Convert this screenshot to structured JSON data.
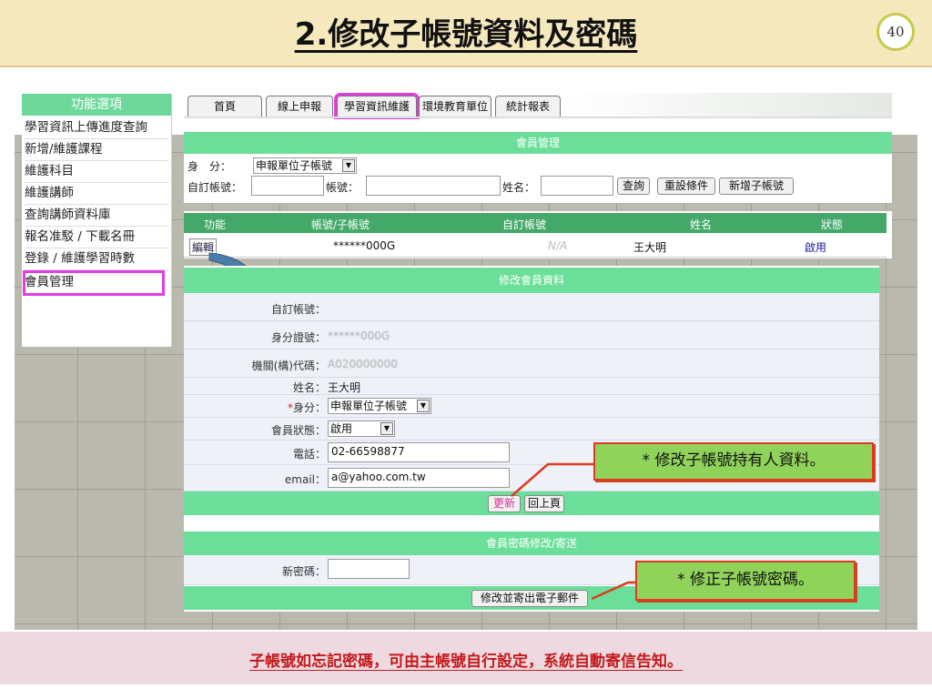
{
  "slide": {
    "title": "2.修改子帳號資料及密碼",
    "page_number": "40",
    "footer": "子帳號如忘記密碼，可由主帳號自行設定，系統自動寄信告知。"
  },
  "sidebar": {
    "header": "功能選項",
    "items": [
      {
        "label": "學習資訊上傳進度查詢"
      },
      {
        "label": "新增/維護課程"
      },
      {
        "label": "維護科目"
      },
      {
        "label": "維護講師"
      },
      {
        "label": "查詢講師資料庫"
      },
      {
        "label": "報名准駁 / 下載名冊"
      },
      {
        "label": "登錄 / 維護學習時數"
      },
      {
        "label": "會員管理"
      }
    ]
  },
  "tabs": [
    {
      "label": "首頁"
    },
    {
      "label": "線上申報"
    },
    {
      "label": "學習資訊維護"
    },
    {
      "label": "環境教育單位"
    },
    {
      "label": "統計報表"
    }
  ],
  "member_mgmt": {
    "title": "會員管理",
    "identity_label": "身　分：",
    "identity_value": "申報單位子帳號",
    "custom_account_label": "自訂帳號：",
    "account_label": "帳號：",
    "name_label": "姓名：",
    "buttons": {
      "query": "查詢",
      "reset": "重設條件",
      "add_sub": "新增子帳號"
    },
    "columns": [
      "功能",
      "帳號/子帳號",
      "自訂帳號",
      "姓名",
      "狀態"
    ],
    "row": {
      "action": "編輯",
      "account": "******000G",
      "custom": "N/A",
      "name": "王大明",
      "status": "啟用"
    }
  },
  "edit_member": {
    "title": "修改會員資料",
    "fields": {
      "custom_account_label": "自訂帳號：",
      "id_label": "身分證號：",
      "id_value": "******000G",
      "org_label": "機關(構)代碼：",
      "org_value": "A020000000",
      "name_label": "姓名：",
      "name_value": "王大明",
      "identity_star": "*",
      "identity_label": "身分：",
      "identity_value": "申報單位子帳號",
      "status_label": "會員狀態：",
      "status_value": "啟用",
      "phone_label": "電話：",
      "phone_value": "02-66598877",
      "email_label": "email：",
      "email_value": "a@yahoo.com.tw"
    },
    "buttons": {
      "update": "更新",
      "back": "回上頁"
    }
  },
  "password": {
    "title": "會員密碼修改/寄送",
    "new_pw_label": "新密碼：",
    "new_pw_value": "",
    "send_button": "修改並寄出電子郵件"
  },
  "callouts": {
    "edit_info": "* 修改子帳號持有人資料。",
    "change_pw": "* 修正子帳號密碼。"
  },
  "colors": {
    "header_bg": "#f5e8bd",
    "green": "#6bdf9a",
    "highlight": "#e23de0",
    "callout_bg": "#8fd35a",
    "callout_border": "#e03a1e",
    "footer_text": "#c21a1a"
  }
}
